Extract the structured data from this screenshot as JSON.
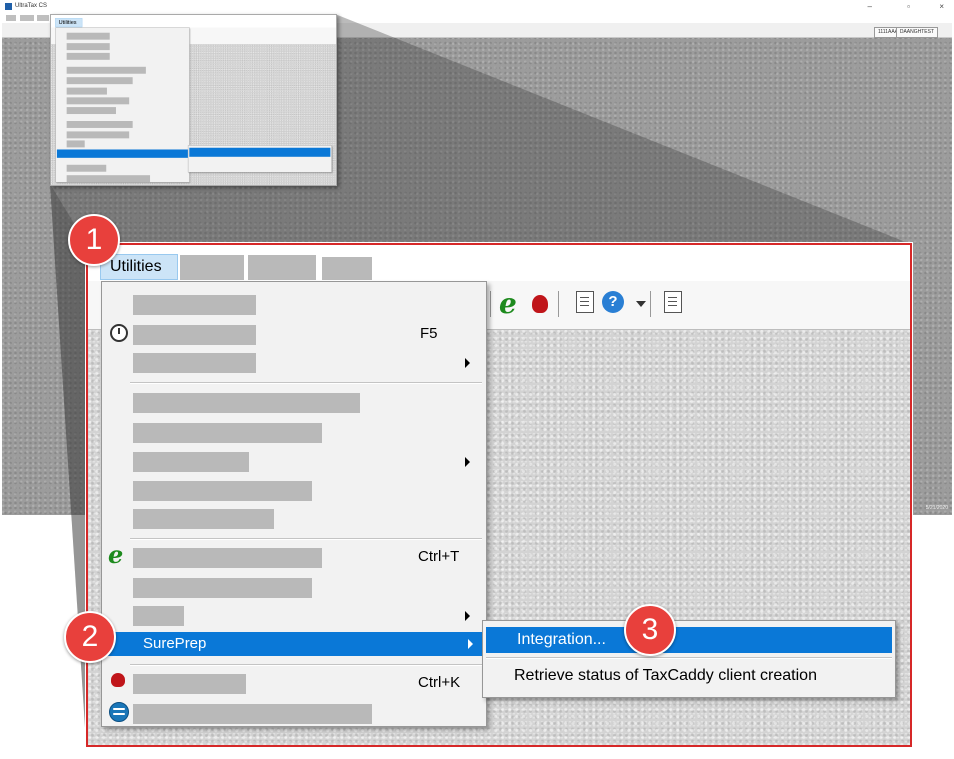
{
  "window": {
    "title": "UltraTax CS",
    "status_buttons": [
      "1111AAA",
      "DAANGHTEST"
    ],
    "date": "5/21/2020",
    "controls": [
      "–",
      "▫",
      "×"
    ]
  },
  "menu": {
    "utilities_label": "Utilities",
    "items": {
      "refresh_shortcut": "F5",
      "etax_shortcut": "Ctrl+T",
      "sureprep_label": "SurePrep",
      "bug_shortcut": "Ctrl+K"
    },
    "submenu": {
      "integration_label": "Integration...",
      "retrieve_label": "Retrieve status of TaxCaddy client creation"
    }
  },
  "badges": [
    "1",
    "2",
    "3"
  ],
  "colors": {
    "highlight": "#0a78d7",
    "badge": "#e8403c",
    "frame": "#d62828",
    "menu_selected": "#cce4f7"
  }
}
